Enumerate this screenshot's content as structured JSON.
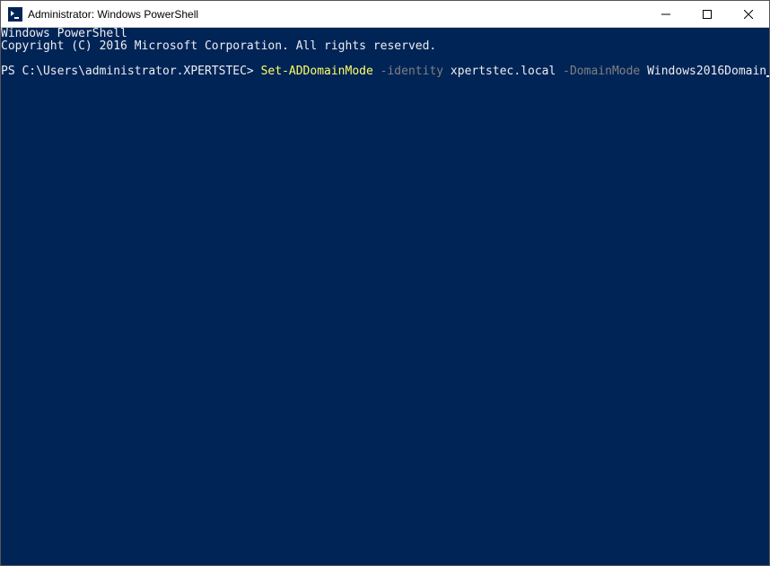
{
  "titlebar": {
    "title": "Administrator: Windows PowerShell"
  },
  "terminal": {
    "header_line1": "Windows PowerShell",
    "header_line2": "Copyright (C) 2016 Microsoft Corporation. All rights reserved.",
    "prompt": "PS C:\\Users\\administrator.XPERTSTEC> ",
    "cmdlet": "Set-ADDomainMode",
    "param1_name": " -identity ",
    "param1_value": "xpertstec.local",
    "param2_name": " -DomainMode ",
    "param2_value": "Windows2016Domain"
  }
}
